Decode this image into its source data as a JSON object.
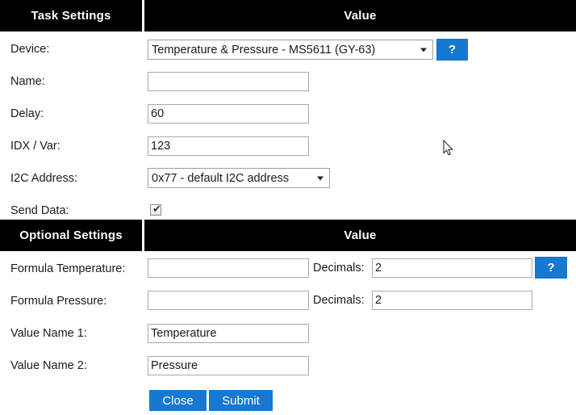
{
  "task_settings": {
    "header_left": "Task Settings",
    "header_right": "Value",
    "rows": {
      "device": {
        "label": "Device:",
        "selected": "Temperature & Pressure - MS5611 (GY-63)",
        "help_label": "?"
      },
      "name": {
        "label": "Name:",
        "value": "",
        "placeholder": ""
      },
      "delay": {
        "label": "Delay:",
        "value": "60"
      },
      "idx_var": {
        "label": "IDX / Var:",
        "value": "123"
      },
      "i2c_address": {
        "label": "I2C Address:",
        "selected": "0x77 - default I2C address"
      },
      "send_data": {
        "label": "Send Data:",
        "checked": "✔"
      }
    }
  },
  "optional_settings": {
    "header_left": "Optional Settings",
    "header_right": "Value",
    "rows": {
      "formula_temperature": {
        "label": "Formula Temperature:",
        "value": "",
        "decimals_label": "Decimals:",
        "decimals_value": "2",
        "help_label": "?"
      },
      "formula_pressure": {
        "label": "Formula Pressure:",
        "value": "",
        "decimals_label": "Decimals:",
        "decimals_value": "2"
      },
      "value_name_1": {
        "label": "Value Name 1:",
        "value": "Temperature"
      },
      "value_name_2": {
        "label": "Value Name 2:",
        "value": "Pressure"
      }
    }
  },
  "actions": {
    "close_label": "Close",
    "submit_label": "Submit"
  },
  "colors": {
    "accent_blue": "#1678d0",
    "header_bg": "#000000",
    "header_text": "#ffffff",
    "field_border": "#a9a9a9"
  }
}
